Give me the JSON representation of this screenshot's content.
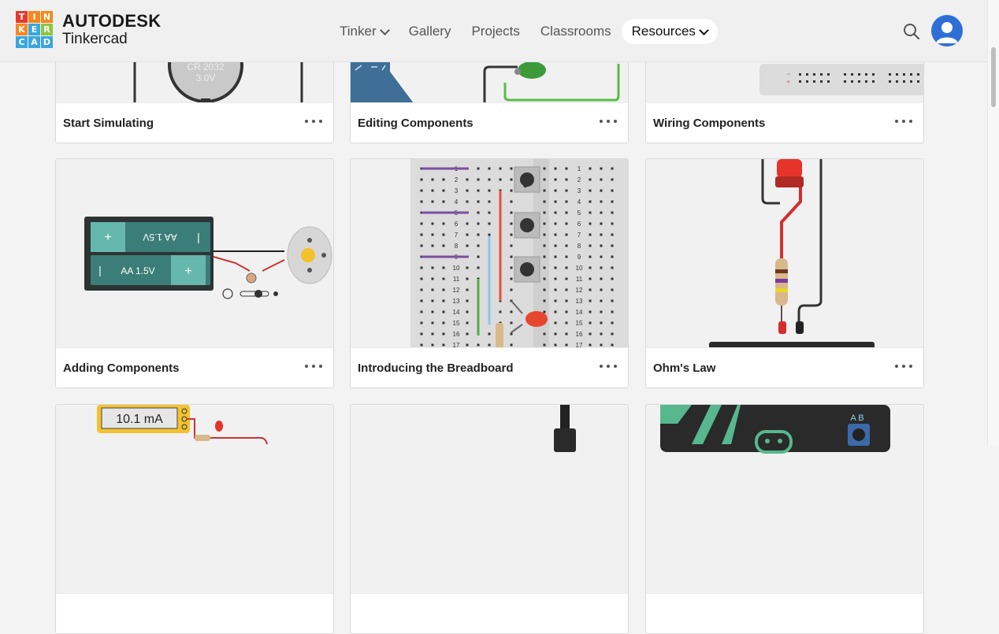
{
  "header": {
    "logo": {
      "cells": [
        {
          "ch": "T",
          "color": "#e5392c"
        },
        {
          "ch": "I",
          "color": "#f5881f"
        },
        {
          "ch": "N",
          "color": "#f5881f"
        },
        {
          "ch": "K",
          "color": "#f5881f"
        },
        {
          "ch": "E",
          "color": "#3aa6dd"
        },
        {
          "ch": "R",
          "color": "#8dc63f"
        },
        {
          "ch": "C",
          "color": "#3aa6dd"
        },
        {
          "ch": "A",
          "color": "#3aa6dd"
        },
        {
          "ch": "D",
          "color": "#3aa6dd"
        }
      ],
      "brand": "AUTODESK",
      "product": "Tinkercad"
    },
    "nav": [
      {
        "label": "Tinker",
        "dropdown": true,
        "active": false
      },
      {
        "label": "Gallery",
        "dropdown": false,
        "active": false
      },
      {
        "label": "Projects",
        "dropdown": false,
        "active": false
      },
      {
        "label": "Classrooms",
        "dropdown": false,
        "active": false
      },
      {
        "label": "Resources",
        "dropdown": true,
        "active": true
      }
    ],
    "search_icon": "search-icon",
    "avatar_icon": "user-avatar-icon"
  },
  "cards": [
    {
      "title": "Start Simulating"
    },
    {
      "title": "Editing Components"
    },
    {
      "title": "Wiring Components"
    },
    {
      "title": "Adding Components"
    },
    {
      "title": "Introducing the Breadboard"
    },
    {
      "title": "Ohm's Law"
    },
    {
      "title": ""
    },
    {
      "title": ""
    },
    {
      "title": ""
    }
  ],
  "thumb_text": {
    "coin_cell_model": "CR 2032",
    "coin_cell_voltage": "3.0V",
    "battery_top": "AA 1.5V",
    "battery_bottom": "AA 1.5V",
    "multimeter_reading": "10.1 mA",
    "microbit_buttons": "A B"
  },
  "colors": {
    "accent": "#2e6fd6",
    "header_bg": "#f0f0f0",
    "page_bg": "#f3f3f3"
  }
}
